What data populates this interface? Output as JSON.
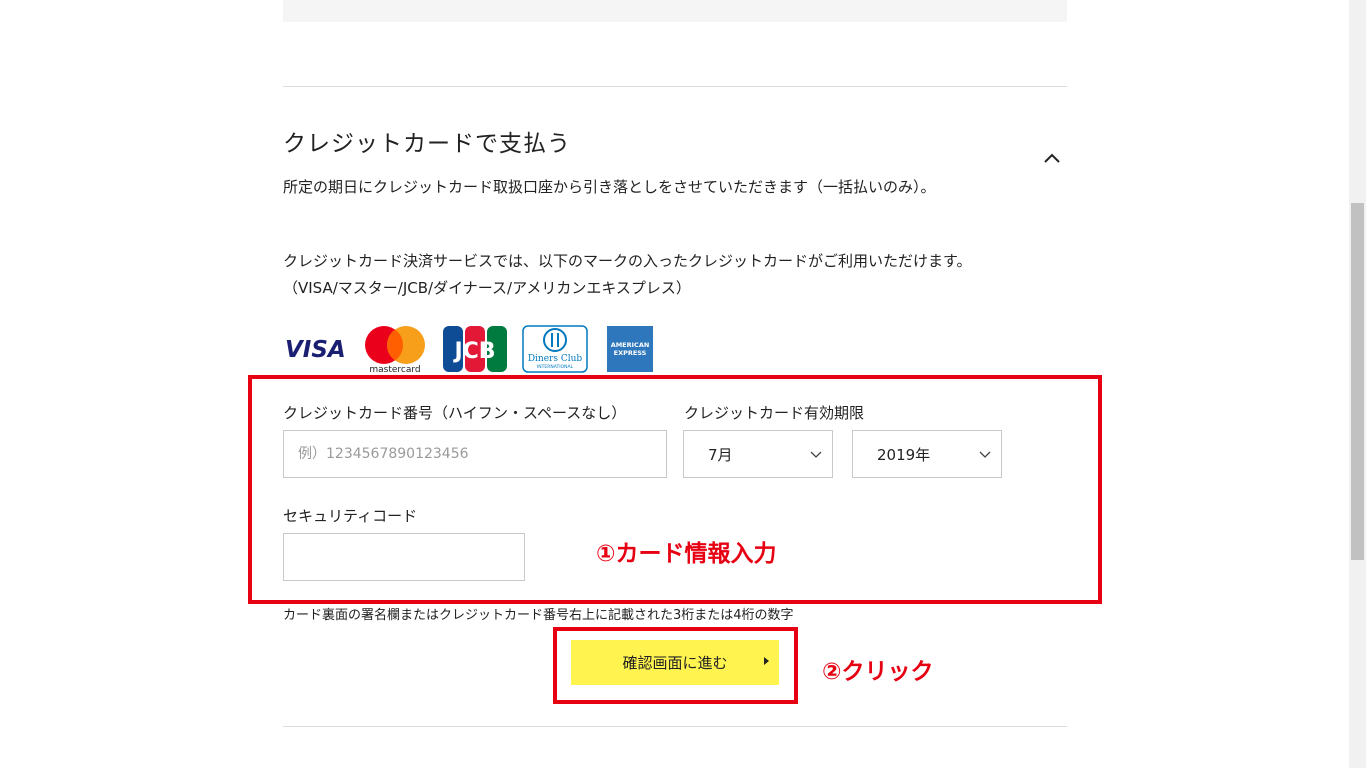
{
  "section": {
    "title": "クレジットカードで支払う",
    "desc1": "所定の期日にクレジットカード取扱口座から引き落としをさせていただきます（一括払いのみ）。",
    "desc2": "クレジットカード決済サービスでは、以下のマークの入ったクレジットカードがご利用いただけます。",
    "desc3": "（VISA/マスター/JCB/ダイナース/アメリカンエキスプレス）"
  },
  "logos": {
    "visa": "VISA",
    "mastercard": "mastercard",
    "jcb": "JCB",
    "diners_line1": "Diners Club",
    "diners_line2": "INTERNATIONAL",
    "amex_line1": "AMERICAN",
    "amex_line2": "EXPRESS"
  },
  "form": {
    "card_number_label": "クレジットカード番号（ハイフン・スペースなし）",
    "card_number_placeholder": "例）1234567890123456",
    "expiry_label": "クレジットカード有効期限",
    "month_value": "7月",
    "year_value": "2019年",
    "security_label": "セキュリティコード",
    "security_note": "カード裏面の署名欄またはクレジットカード番号右上に記載された3桁または4桁の数字",
    "confirm_button": "確認画面に進む"
  },
  "annotations": {
    "step1": "①カード情報入力",
    "step2": "②クリック"
  },
  "colors": {
    "annotation_red": "#e60012",
    "button_yellow": "#fff44f"
  }
}
